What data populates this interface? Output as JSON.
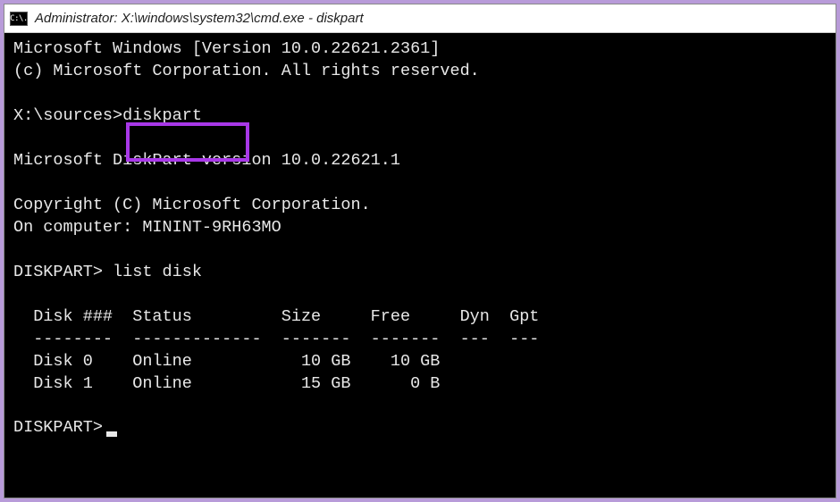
{
  "titlebar": {
    "icon_label": "C:\\.",
    "title": "Administrator: X:\\windows\\system32\\cmd.exe - diskpart"
  },
  "terminal": {
    "line_version": "Microsoft Windows [Version 10.0.22621.2361]",
    "line_copyright1": "(c) Microsoft Corporation. All rights reserved.",
    "prompt1_path": "X:\\sources>",
    "prompt1_cmd": "diskpart",
    "line_diskpart_ver": "Microsoft DiskPart version 10.0.22621.1",
    "line_copyright2": "Copyright (C) Microsoft Corporation.",
    "line_computer": "On computer: MININT-9RH63MO",
    "prompt2_label": "DISKPART>",
    "prompt2_cmd": "list disk",
    "table_header": "  Disk ###  Status         Size     Free     Dyn  Gpt",
    "table_divider": "  --------  -------------  -------  -------  ---  ---",
    "table_rows": [
      "  Disk 0    Online           10 GB    10 GB",
      "  Disk 1    Online           15 GB      0 B"
    ],
    "prompt3_label": "DISKPART>"
  },
  "highlight": {
    "color": "#a838e8",
    "target": "diskpart command"
  }
}
